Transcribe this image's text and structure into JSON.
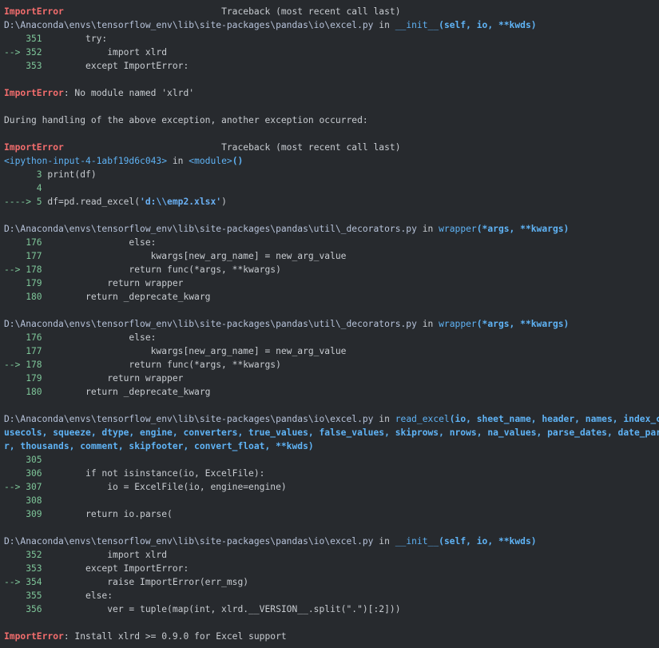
{
  "colors": {
    "background": "#272a2e",
    "error": "#f26d6d",
    "line_number": "#7ec699",
    "function_name": "#5fb3f5",
    "text": "#c8ccd1"
  },
  "traceback1": {
    "error_name": "ImportError",
    "header": "                             Traceback (most recent call last)",
    "frame": {
      "path": "D:\\Anaconda\\envs\\tensorflow_env\\lib\\site-packages\\pandas\\io\\excel.py",
      "in": " in ",
      "func": "__init__",
      "args": "(self, io, **kwds)"
    },
    "lines": [
      {
        "num": "    351",
        "code": "        try:"
      },
      {
        "num": "--> 352",
        "code": "            import xlrd"
      },
      {
        "num": "    353",
        "code": "        except ImportError:"
      }
    ]
  },
  "error1": {
    "name": "ImportError",
    "message": ": No module named 'xlrd'"
  },
  "during_handling": "During handling of the above exception, another exception occurred:",
  "traceback2": {
    "error_name": "ImportError",
    "header": "                             Traceback (most recent call last)",
    "frame": {
      "path": "<ipython-input-4-1abf19d6c043>",
      "in": " in ",
      "func": "<module>",
      "args": "()"
    },
    "lines": [
      {
        "num": "      3",
        "code": " print(df)"
      },
      {
        "num": "      4",
        "code": ""
      },
      {
        "num": "----> 5",
        "code_pre": " df=pd.read_excel(",
        "code_str": "'d:\\\\emp2.xlsx'",
        "code_post": ")"
      }
    ]
  },
  "frame_decorators_1": {
    "path": "D:\\Anaconda\\envs\\tensorflow_env\\lib\\site-packages\\pandas\\util\\_decorators.py",
    "in": " in ",
    "func": "wrapper",
    "args": "(*args, **kwargs)",
    "lines": [
      {
        "num": "    176",
        "code": "                else:"
      },
      {
        "num": "    177",
        "code": "                    kwargs[new_arg_name] = new_arg_value"
      },
      {
        "num": "--> 178",
        "code": "                return func(*args, **kwargs)"
      },
      {
        "num": "    179",
        "code": "            return wrapper"
      },
      {
        "num": "    180",
        "code": "        return _deprecate_kwarg"
      }
    ]
  },
  "frame_decorators_2": {
    "path": "D:\\Anaconda\\envs\\tensorflow_env\\lib\\site-packages\\pandas\\util\\_decorators.py",
    "in": " in ",
    "func": "wrapper",
    "args": "(*args, **kwargs)",
    "lines": [
      {
        "num": "    176",
        "code": "                else:"
      },
      {
        "num": "    177",
        "code": "                    kwargs[new_arg_name] = new_arg_value"
      },
      {
        "num": "--> 178",
        "code": "                return func(*args, **kwargs)"
      },
      {
        "num": "    179",
        "code": "            return wrapper"
      },
      {
        "num": "    180",
        "code": "        return _deprecate_kwarg"
      }
    ]
  },
  "frame_read_excel": {
    "path": "D:\\Anaconda\\envs\\tensorflow_env\\lib\\site-packages\\pandas\\io\\excel.py",
    "in": " in ",
    "func": "read_excel",
    "args_line1": "(io, sheet_name, header, names, index_col,",
    "args_line2": "usecols, squeeze, dtype, engine, converters, true_values, false_values, skiprows, nrows, na_values, parse_dates, date_parse",
    "args_line3": "r, thousands, comment, skipfooter, convert_float, **kwds)",
    "lines": [
      {
        "num": "    305",
        "code": ""
      },
      {
        "num": "    306",
        "code": "        if not isinstance(io, ExcelFile):"
      },
      {
        "num": "--> 307",
        "code": "            io = ExcelFile(io, engine=engine)"
      },
      {
        "num": "    308",
        "code": ""
      },
      {
        "num": "    309",
        "code": "        return io.parse("
      }
    ]
  },
  "frame_excel_init": {
    "path": "D:\\Anaconda\\envs\\tensorflow_env\\lib\\site-packages\\pandas\\io\\excel.py",
    "in": " in ",
    "func": "__init__",
    "args": "(self, io, **kwds)",
    "lines": [
      {
        "num": "    352",
        "code": "            import xlrd"
      },
      {
        "num": "    353",
        "code": "        except ImportError:"
      },
      {
        "num": "--> 354",
        "code": "            raise ImportError(err_msg)"
      },
      {
        "num": "    355",
        "code": "        else:"
      },
      {
        "num": "    356",
        "code": "            ver = tuple(map(int, xlrd.__VERSION__.split(\".\")[:2]))"
      }
    ]
  },
  "final_error": {
    "name": "ImportError",
    "message": ": Install xlrd >= 0.9.0 for Excel support"
  }
}
